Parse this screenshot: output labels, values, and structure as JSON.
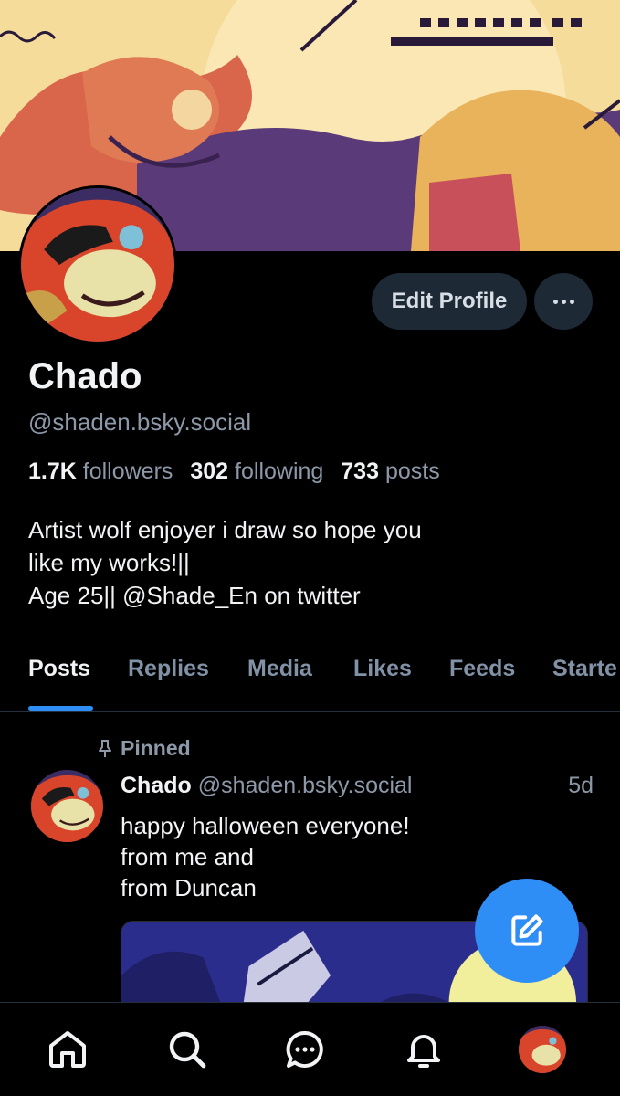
{
  "profile": {
    "display_name": "Chado",
    "handle": "@shaden.bsky.social",
    "edit_label": "Edit Profile",
    "more_label": "More options",
    "stats": {
      "followers_count": "1.7K",
      "followers_label": "followers",
      "following_count": "302",
      "following_label": "following",
      "posts_count": "733",
      "posts_label": "posts"
    },
    "bio_lines": [
      "Artist wolf enjoyer i draw so hope you",
      "like my works!||",
      "Age 25|| @Shade_En on twitter"
    ]
  },
  "tabs": [
    {
      "label": "Posts",
      "active": true
    },
    {
      "label": "Replies",
      "active": false
    },
    {
      "label": "Media",
      "active": false
    },
    {
      "label": "Likes",
      "active": false
    },
    {
      "label": "Feeds",
      "active": false
    },
    {
      "label": "Starte",
      "active": false
    }
  ],
  "pinned_post": {
    "pinned_label": "Pinned",
    "author_name": "Chado",
    "author_handle": "@shaden.bsky.social",
    "time": "5d",
    "text_lines": [
      "happy halloween everyone!",
      "from me and",
      "from Duncan"
    ]
  },
  "fab": {
    "icon": "compose-icon"
  },
  "bottom_nav": [
    {
      "icon": "home-icon"
    },
    {
      "icon": "search-icon"
    },
    {
      "icon": "chat-icon"
    },
    {
      "icon": "bell-icon"
    },
    {
      "icon": "avatar"
    }
  ],
  "colors": {
    "background": "#000000",
    "accent": "#2f8df6",
    "muted_text": "#8d99a8",
    "button_bg": "#1e2936"
  }
}
